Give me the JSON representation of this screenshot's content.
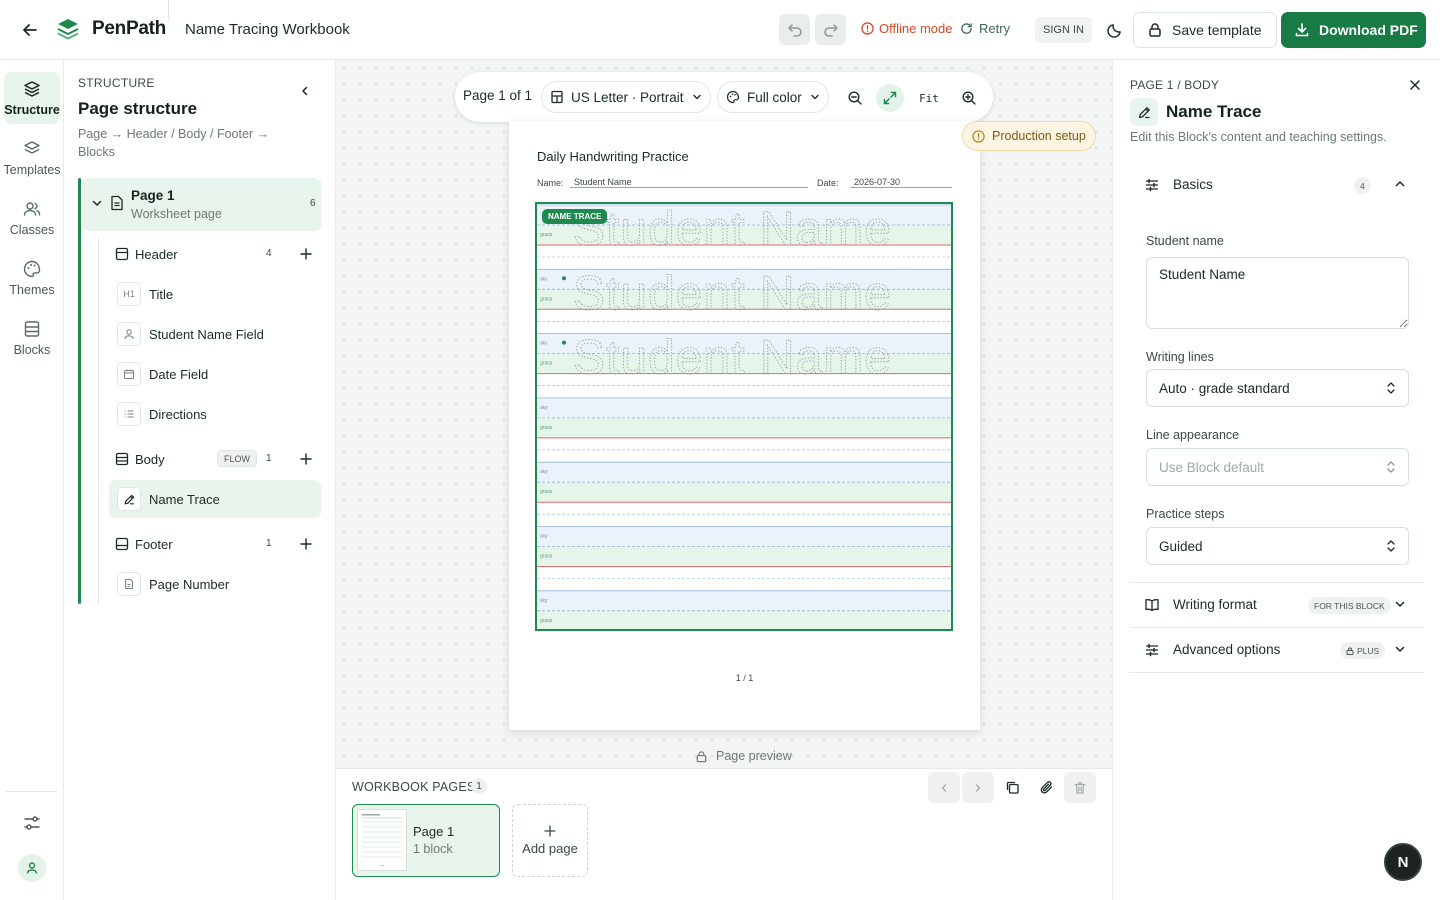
{
  "app": {
    "brand": "PenPath",
    "doc_title": "Name Tracing Workbook",
    "offline_label": "Offline mode",
    "retry_label": "Retry",
    "signin_label": "SIGN IN",
    "save_label": "Save template",
    "download_label": "Download PDF",
    "accent_color": "#187a45",
    "offline_color": "#d14a28"
  },
  "rail": {
    "items": [
      {
        "label": "Structure",
        "icon": "layers-icon",
        "active": true
      },
      {
        "label": "Templates",
        "icon": "stack-icon",
        "active": false
      },
      {
        "label": "Classes",
        "icon": "users-icon",
        "active": false
      },
      {
        "label": "Themes",
        "icon": "palette-icon",
        "active": false
      },
      {
        "label": "Blocks",
        "icon": "blocks-icon",
        "active": false
      }
    ]
  },
  "structure": {
    "kicker": "STRUCTURE",
    "heading": "Page structure",
    "description": "Page → Header / Body / Footer → Blocks",
    "page": {
      "title": "Page 1",
      "subtitle": "Worksheet page",
      "count": "6"
    },
    "header": {
      "label": "Header",
      "count": "4"
    },
    "header_blocks": [
      {
        "label": "Title",
        "icon_text": "H1"
      },
      {
        "label": "Student Name Field",
        "icon_text": ""
      },
      {
        "label": "Date Field",
        "icon_text": ""
      },
      {
        "label": "Directions",
        "icon_text": ""
      }
    ],
    "body": {
      "label": "Body",
      "flow": "FLOW",
      "count": "1"
    },
    "body_blocks": [
      {
        "label": "Name Trace",
        "active": true
      }
    ],
    "footer": {
      "label": "Footer",
      "count": "1"
    },
    "footer_blocks": [
      {
        "label": "Page Number"
      }
    ]
  },
  "canvas": {
    "page_of": "Page 1 of 1",
    "paper_size": "US Letter · Portrait",
    "color_mode": "Full color",
    "fit_label": "Fit",
    "production_setup": "Production setup",
    "preview_label": "Page preview"
  },
  "sheet": {
    "title": "Daily Handwriting Practice",
    "name_label": "Name:",
    "name_value": "Student Name",
    "date_label": "Date:",
    "date_value": "2026-07-30",
    "block_badge": "NAME TRACE",
    "trace_text": "Student Name",
    "sky_label": "sky",
    "grass_label": "grass",
    "page_number": "1 / 1"
  },
  "workbook": {
    "label": "WORKBOOK PAGES",
    "count": "1",
    "pages": [
      {
        "title": "Page 1",
        "subtitle": "1 block"
      }
    ],
    "add_label": "Add page"
  },
  "inspector": {
    "crumb": "PAGE 1 / BODY",
    "title": "Name Trace",
    "subtitle": "Edit this Block's content and teaching settings.",
    "basics": {
      "label": "Basics",
      "count": "4"
    },
    "student_name_label": "Student name",
    "student_name_value": "Student Name",
    "writing_lines_label": "Writing lines",
    "writing_lines_value": "Auto · grade standard",
    "line_appearance_label": "Line appearance",
    "line_appearance_placeholder": "Use Block default",
    "practice_steps_label": "Practice steps",
    "practice_steps_value": "Guided",
    "writing_format": {
      "label": "Writing format",
      "pill": "FOR THIS BLOCK"
    },
    "advanced": {
      "label": "Advanced options",
      "pill": "PLUS"
    },
    "fab_label": "N"
  }
}
